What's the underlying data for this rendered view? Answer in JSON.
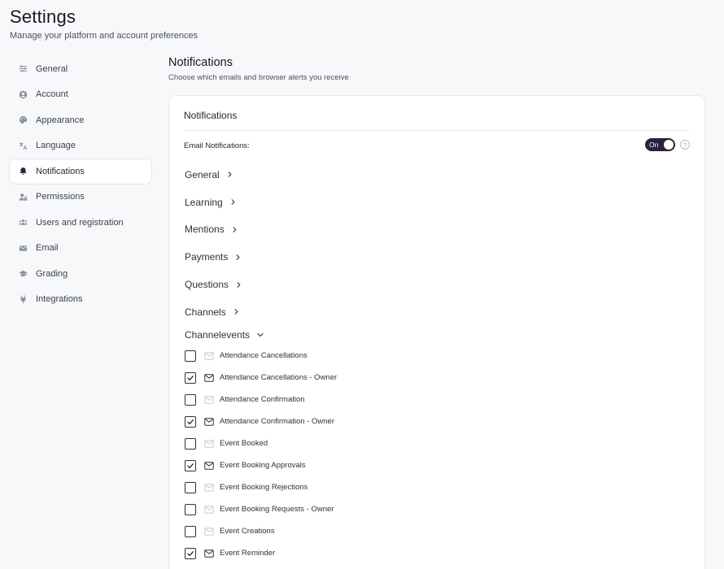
{
  "page": {
    "title": "Settings",
    "subtitle": "Manage your platform and account preferences"
  },
  "sidebar": {
    "items": [
      {
        "label": "General",
        "icon": "sliders-icon",
        "active": false
      },
      {
        "label": "Account",
        "icon": "user-circle-icon",
        "active": false
      },
      {
        "label": "Appearance",
        "icon": "palette-icon",
        "active": false
      },
      {
        "label": "Language",
        "icon": "translate-icon",
        "active": false
      },
      {
        "label": "Notifications",
        "icon": "bell-icon",
        "active": true
      },
      {
        "label": "Permissions",
        "icon": "user-lock-icon",
        "active": false
      },
      {
        "label": "Users and registration",
        "icon": "users-icon",
        "active": false
      },
      {
        "label": "Email",
        "icon": "envelope-icon",
        "active": false
      },
      {
        "label": "Grading",
        "icon": "graduation-cap-icon",
        "active": false
      },
      {
        "label": "Integrations",
        "icon": "plug-icon",
        "active": false
      }
    ]
  },
  "main": {
    "title": "Notifications",
    "subtitle": "Choose which emails and browser alerts you receive",
    "card": {
      "header": "Notifications",
      "email_notifications": {
        "label": "Email Notifications:",
        "toggle_label": "On",
        "enabled": true,
        "help_glyph": "?"
      },
      "sections": [
        {
          "label": "General",
          "expanded": false
        },
        {
          "label": "Learning",
          "expanded": false
        },
        {
          "label": "Mentions",
          "expanded": false
        },
        {
          "label": "Payments",
          "expanded": false
        },
        {
          "label": "Questions",
          "expanded": false
        },
        {
          "label": "Channels",
          "expanded": false
        }
      ],
      "expanded_section": {
        "label": "Channelevents",
        "expanded": true,
        "events": [
          {
            "label": "Attendance Cancellations",
            "checked": false
          },
          {
            "label": "Attendance Cancellations - Owner",
            "checked": true
          },
          {
            "label": "Attendance Confirmation",
            "checked": false
          },
          {
            "label": "Attendance Confirmation - Owner",
            "checked": true
          },
          {
            "label": "Event Booked",
            "checked": false
          },
          {
            "label": "Event Booking Approvals",
            "checked": true
          },
          {
            "label": "Event Booking Rejections",
            "checked": false
          },
          {
            "label": "Event Booking Requests - Owner",
            "checked": false
          },
          {
            "label": "Event Creations",
            "checked": false
          },
          {
            "label": "Event Reminder",
            "checked": true
          }
        ]
      }
    }
  },
  "colors": {
    "toggle_on": "#2d1f3d",
    "mail_icon_active": "#2b3140",
    "mail_icon_inactive": "#c8ccd4"
  }
}
